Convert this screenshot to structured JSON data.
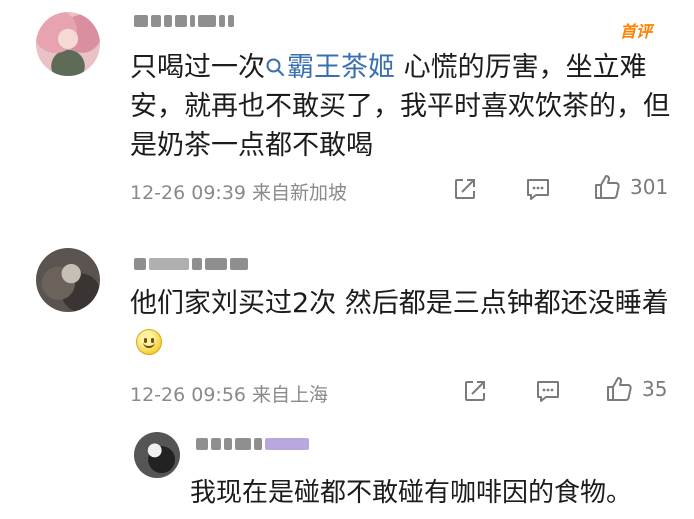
{
  "comments": [
    {
      "avatar": "pink-haired-anime-avatar",
      "badge": "首评",
      "text_before": "只喝过一次",
      "topic": "霸王茶姬",
      "text_after": " 心慌的厉害，坐立难安，就再也不敢买了，我平时喜欢饮茶的，但是奶茶一点都不敢喝",
      "meta": "12-26 09:39 来自新加坡",
      "likes": "301"
    },
    {
      "avatar": "dark-portrait-avatar",
      "text": "他们家刘买过2次 然后都是三点钟都还没睡着",
      "emoji": "smiley-face-emoji",
      "meta": "12-26 09:56 来自上海",
      "likes": "35"
    }
  ],
  "reply": {
    "avatar": "black-white-avatar",
    "text": "我现在是碰都不敢碰有咖啡因的食物。"
  },
  "colors": {
    "topic_link": "#3a6fb0",
    "badge": "#ff8200",
    "meta_gray": "#8a8a8a"
  }
}
